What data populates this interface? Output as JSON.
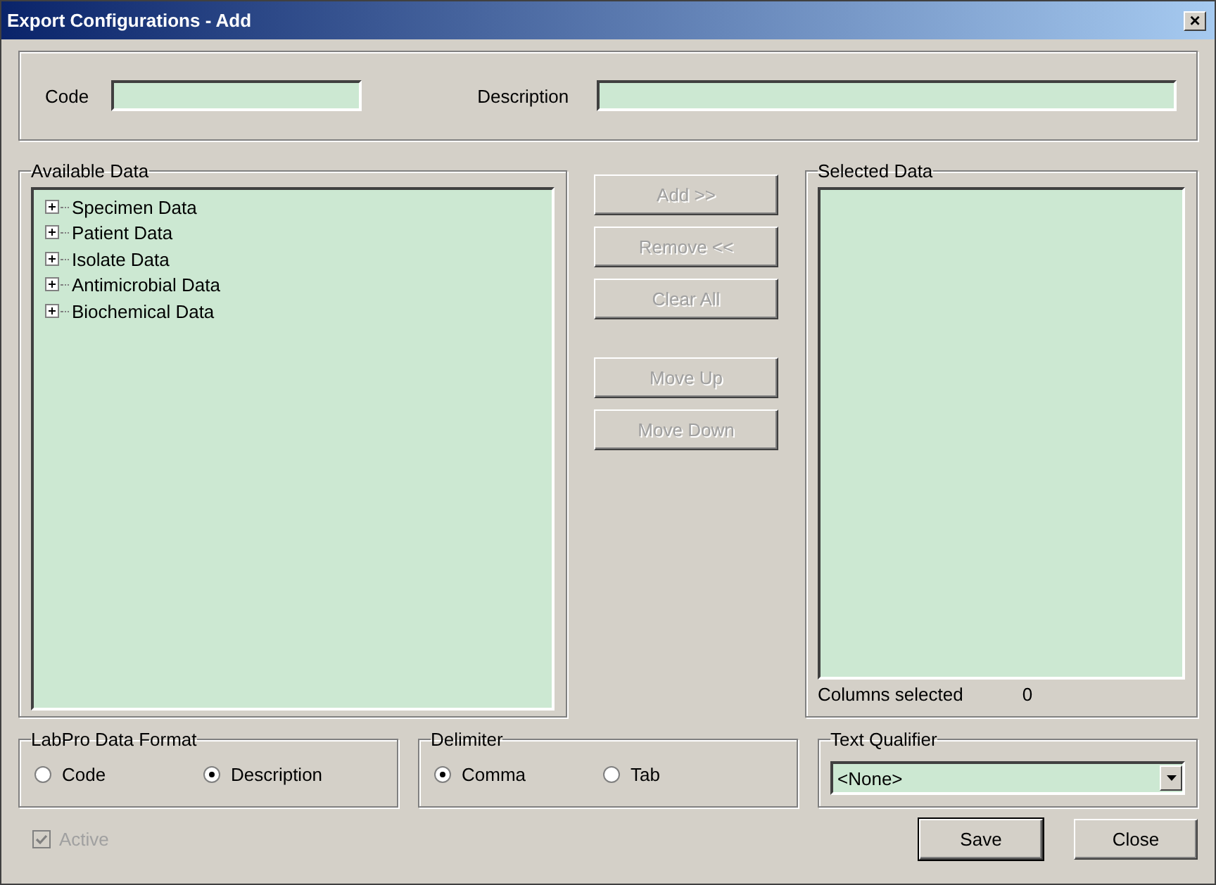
{
  "window": {
    "title": "Export Configurations - Add",
    "close": "×"
  },
  "header": {
    "code_label": "Code",
    "description_label": "Description"
  },
  "available": {
    "title": "Available Data",
    "items": [
      {
        "label": "Specimen Data",
        "expanded": false
      },
      {
        "label": "Patient Data",
        "expanded": false
      },
      {
        "label": "Isolate Data",
        "expanded": false
      },
      {
        "label": "Antimicrobial Data",
        "expanded": false
      },
      {
        "label": "Biochemical Data",
        "expanded": false
      }
    ]
  },
  "action_groups": [
    [
      {
        "label": "Add >>",
        "disabled": true
      },
      {
        "label": "Remove <<",
        "disabled": true
      },
      {
        "label": "Clear All",
        "disabled": true
      }
    ],
    [
      {
        "label": "Move Up",
        "disabled": true
      },
      {
        "label": "Move Down",
        "disabled": true
      }
    ]
  ],
  "selected": {
    "title": "Selected Data",
    "count_label": "Columns selected",
    "count": "0"
  },
  "format": {
    "title": "LabPro Data Format",
    "options": [
      {
        "label": "Code",
        "selected": false
      },
      {
        "label": "Description",
        "selected": true
      }
    ]
  },
  "delimiter": {
    "title": "Delimiter",
    "options": [
      {
        "label": "Comma",
        "selected": true
      },
      {
        "label": "Tab",
        "selected": false
      }
    ]
  },
  "qualifier": {
    "title": "Text Qualifier",
    "value": "<None>"
  },
  "active": {
    "label": "Active",
    "checked": true,
    "disabled": true
  },
  "buttons": [
    {
      "label": "Save",
      "default": true
    },
    {
      "label": "Close",
      "default": false
    }
  ]
}
